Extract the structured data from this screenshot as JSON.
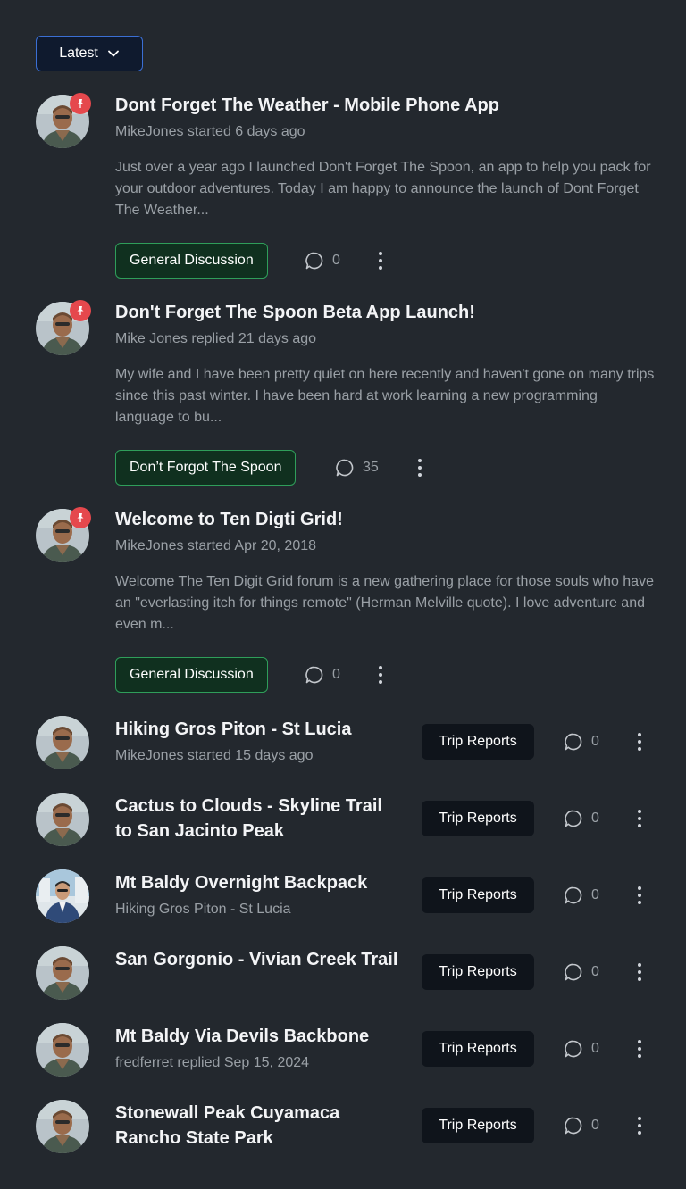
{
  "sort": {
    "label": "Latest"
  },
  "discussions": [
    {
      "title": "Dont Forget The Weather - Mobile Phone App",
      "meta": "MikeJones started 6 days ago",
      "excerpt": "Just over a year ago I launched Don't Forget The Spoon, an app to help you pack for your outdoor adventures. Today I am happy to announce the launch of Dont Forget The Weather...",
      "category": "General Discussion",
      "comments": "0",
      "pinned": true
    },
    {
      "title": "Don't Forget The Spoon Beta App Launch!",
      "meta": "Mike Jones replied 21 days ago",
      "excerpt": "My wife and I have been pretty quiet on here recently and haven't gone on many trips since this past winter. I have been hard at work learning a new programming language to bu...",
      "category": "Don’t Forgot The Spoon",
      "comments": "35",
      "pinned": true
    },
    {
      "title": "Welcome to Ten Digti Grid!",
      "meta": "MikeJones started Apr 20, 2018",
      "excerpt": "Welcome The Ten Digit Grid forum is a new gathering place for those souls who have an \"everlasting itch for things remote\" (Herman Melville quote). I love adventure and even m...",
      "category": "General Discussion",
      "comments": "0",
      "pinned": true
    },
    {
      "title": "Hiking Gros Piton - St Lucia",
      "meta": "MikeJones started 15 days ago",
      "category": "Trip Reports",
      "comments": "0"
    },
    {
      "title": "Cactus to Clouds - Skyline Trail to San Jacinto Peak",
      "meta": "",
      "category": "Trip Reports",
      "comments": "0"
    },
    {
      "title": "Mt Baldy Overnight Backpack",
      "meta": "Hiking Gros Piton - St Lucia",
      "category": "Trip Reports",
      "comments": "0"
    },
    {
      "title": "San Gorgonio - Vivian Creek Trail",
      "meta": "",
      "category": "Trip Reports",
      "comments": "0"
    },
    {
      "title": "Mt Baldy Via Devils Backbone",
      "meta": "fredferret replied Sep 15, 2024",
      "category": "Trip Reports",
      "comments": "0"
    },
    {
      "title": "Stonewall Peak Cuyamaca Rancho State Park",
      "meta": "",
      "category": "Trip Reports",
      "comments": "0"
    }
  ]
}
